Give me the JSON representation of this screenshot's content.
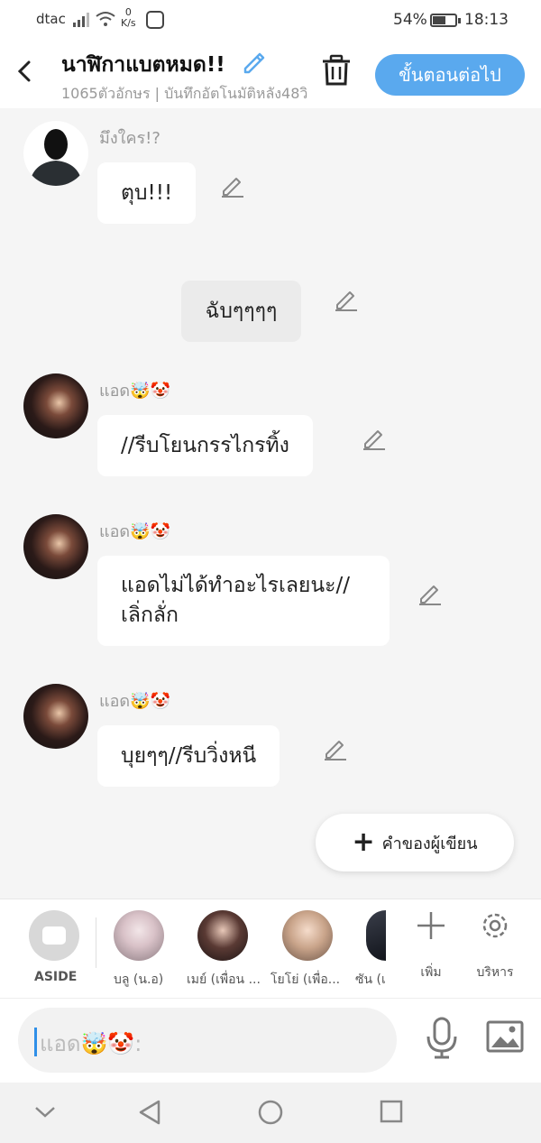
{
  "status_bar": {
    "carrier": "dtac",
    "net_speed_value": "0",
    "net_speed_unit": "K/s",
    "battery_percent": "54%",
    "battery_level": 0.54,
    "time": "18:13"
  },
  "header": {
    "title": "นาฬิกาแบตหมด!!",
    "subtitle": "1065ตัวอักษร | บันทึกอัตโนมัติหลัง48วิ",
    "next_label": "ขั้นตอนต่อไป"
  },
  "messages": [
    {
      "sender": "มึงใคร!?",
      "text": "ตุบ!!!"
    },
    {
      "sender": "",
      "text": "ฉับๆๆๆๆ"
    },
    {
      "sender": "แอด🤯🤡",
      "text": "//รีบโยนกรรไกรทิ้ง"
    },
    {
      "sender": "แอด🤯🤡",
      "text": "แอดไม่ได้ทำอะไรเลยนะ//เลิ่กลั่ก"
    },
    {
      "sender": "แอด🤯🤡",
      "text": "บุยๆๆ//รีบวิ่งหนี"
    }
  ],
  "author_button_label": "คำของผู้เขียน",
  "characters": {
    "aside_label": "ASIDE",
    "items": [
      {
        "label": "บลู (น.อ)"
      },
      {
        "label": "เมย์ (เพื่อน ..."
      },
      {
        "label": "โยโย่ (เพื่อ..."
      },
      {
        "label": "ซัน (เ"
      }
    ],
    "add_label": "เพิ่ม",
    "manage_label": "บริหาร"
  },
  "input": {
    "placeholder": "แอด🤯🤡:"
  },
  "colors": {
    "accent": "#5aa9ee",
    "bubble": "#ffffff",
    "aside_bubble": "#ebebeb",
    "background": "#f5f5f5"
  },
  "icons": [
    "back-icon",
    "edit-icon",
    "trash-icon",
    "pencil-icon",
    "plus-icon",
    "gear-icon",
    "mic-icon",
    "image-icon",
    "nav-down-icon",
    "nav-back-icon",
    "nav-home-icon",
    "nav-recents-icon"
  ]
}
